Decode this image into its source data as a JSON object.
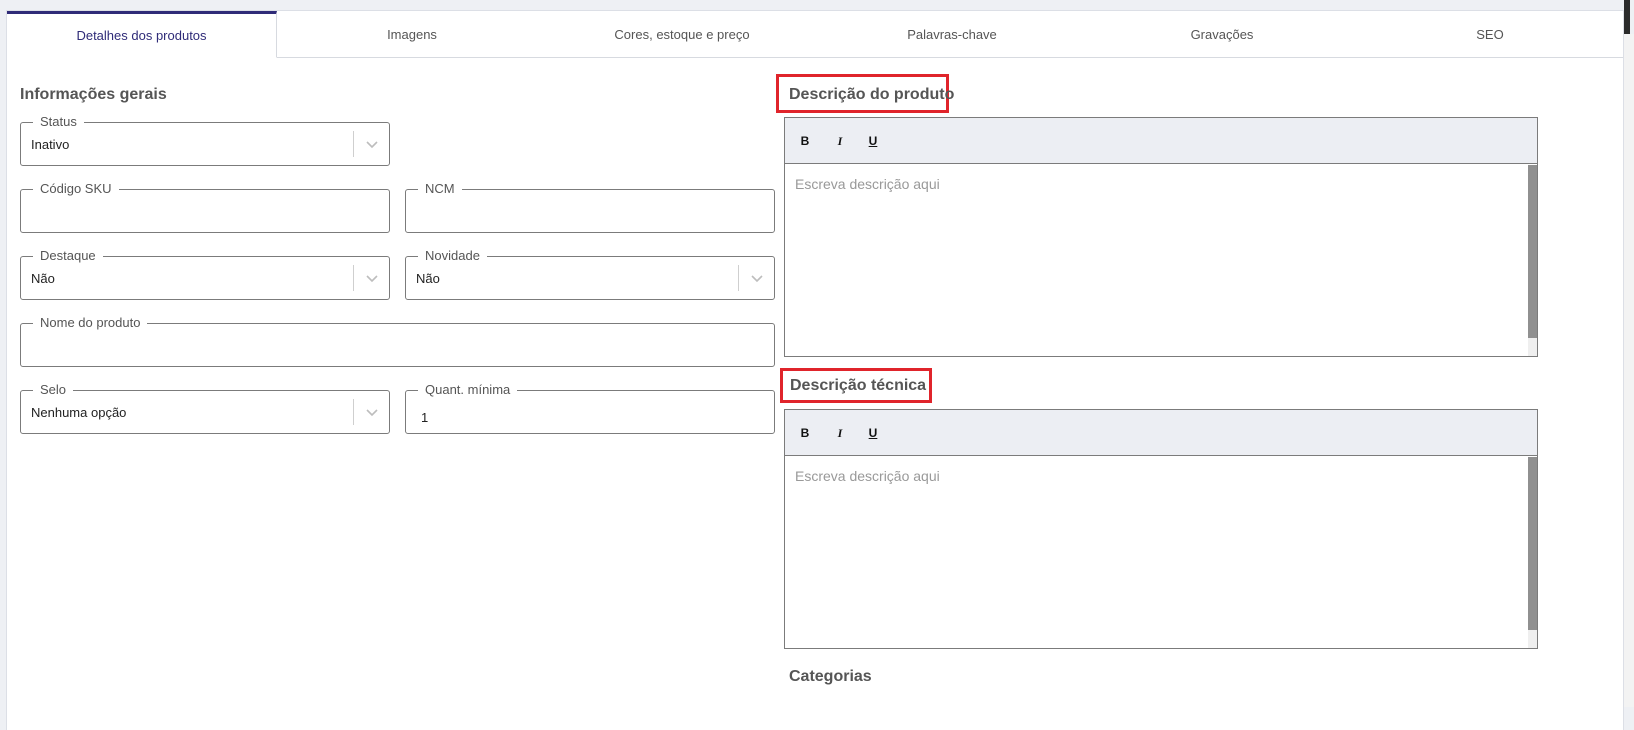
{
  "tabs": [
    {
      "label": "Detalhes dos produtos",
      "active": true
    },
    {
      "label": "Imagens",
      "active": false
    },
    {
      "label": "Cores, estoque e preço",
      "active": false
    },
    {
      "label": "Palavras-chave",
      "active": false
    },
    {
      "label": "Gravações",
      "active": false
    },
    {
      "label": "SEO",
      "active": false
    }
  ],
  "general": {
    "title": "Informações gerais",
    "status": {
      "label": "Status",
      "value": "Inativo"
    },
    "sku": {
      "label": "Código SKU",
      "value": ""
    },
    "ncm": {
      "label": "NCM",
      "value": ""
    },
    "destaque": {
      "label": "Destaque",
      "value": "Não"
    },
    "novidade": {
      "label": "Novidade",
      "value": "Não"
    },
    "nome": {
      "label": "Nome do produto",
      "value": ""
    },
    "selo": {
      "label": "Selo",
      "value": "Nenhuma opção"
    },
    "quant": {
      "label": "Quant. mínima",
      "value": "1"
    }
  },
  "descricao_produto": {
    "title": "Descrição do produto",
    "placeholder": "Escreva descrição aqui",
    "toolbar": {
      "bold": "B",
      "italic": "I",
      "underline": "U"
    }
  },
  "descricao_tecnica": {
    "title": "Descrição técnica",
    "placeholder": "Escreva descrição aqui",
    "toolbar": {
      "bold": "B",
      "italic": "I",
      "underline": "U"
    }
  },
  "categorias": {
    "title": "Categorias"
  },
  "colors": {
    "accent": "#2f2b78",
    "highlight": "#e0242b"
  }
}
